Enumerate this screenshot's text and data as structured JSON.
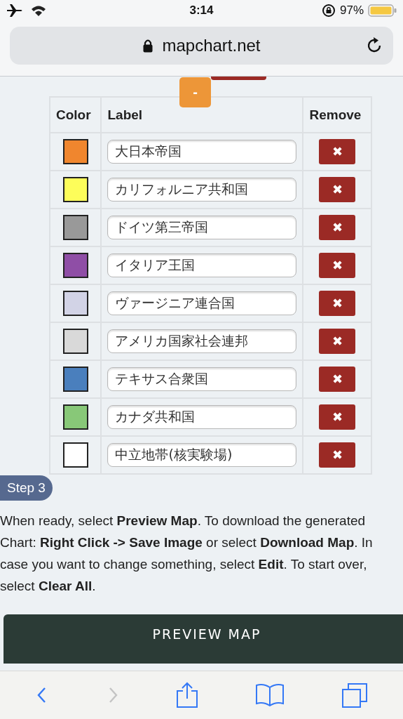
{
  "status_bar": {
    "time": "3:14",
    "battery": "97%"
  },
  "address_bar": {
    "url": "mapchart.net"
  },
  "collapse_button": {
    "label": "-"
  },
  "table": {
    "columns": [
      "Color",
      "Label",
      "Remove"
    ],
    "rows": [
      {
        "color": "#f0862e",
        "label": "大日本帝国",
        "remove": "✖"
      },
      {
        "color": "#fdfd5a",
        "label": "カリフォルニア共和国",
        "remove": "✖"
      },
      {
        "color": "#999999",
        "label": "ドイツ第三帝国",
        "remove": "✖"
      },
      {
        "color": "#8f4ea6",
        "label": "イタリア王国",
        "remove": "✖"
      },
      {
        "color": "#d2d3e6",
        "label": "ヴァージニア連合国",
        "remove": "✖"
      },
      {
        "color": "#d9d9d9",
        "label": "アメリカ国家社会連邦",
        "remove": "✖"
      },
      {
        "color": "#4a7fbd",
        "label": "テキサス合衆国",
        "remove": "✖"
      },
      {
        "color": "#88c878",
        "label": "カナダ共和国",
        "remove": "✖"
      },
      {
        "color": "#ffffff",
        "label": "中立地帯(核実験場)",
        "remove": "✖"
      }
    ]
  },
  "step": {
    "badge": "Step 3",
    "text": "When ready, select **Preview Map**. To download the generated Chart: **Right Click -> Save Image** or select **Download Map**. In case you want to change something, select **Edit**. To start over, select **Clear All**."
  },
  "preview_button": {
    "label": "PREVIEW MAP"
  },
  "toolbar": [
    {
      "kind": "back",
      "disabled": false
    },
    {
      "kind": "forward",
      "disabled": true
    },
    {
      "kind": "share",
      "disabled": false
    },
    {
      "kind": "bookmarks",
      "disabled": false
    },
    {
      "kind": "tabs",
      "disabled": false
    }
  ]
}
